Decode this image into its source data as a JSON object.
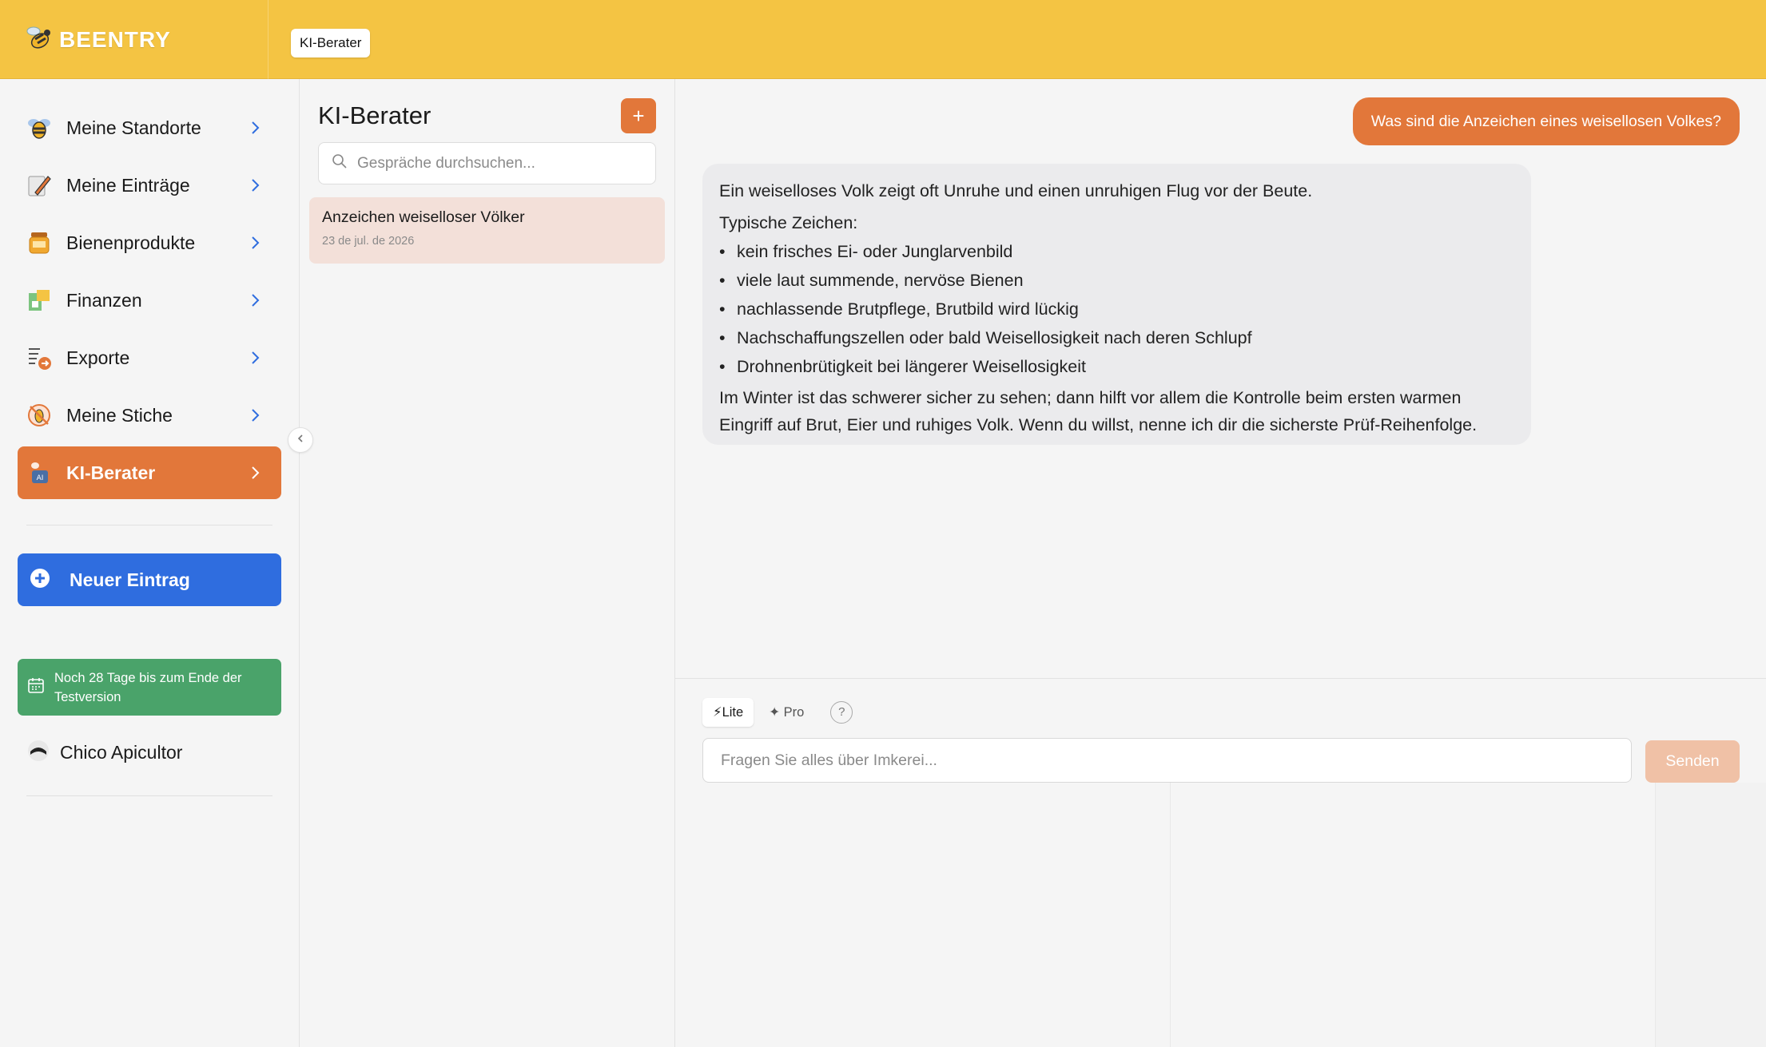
{
  "app": {
    "logo_text": "BEENTRY",
    "top_tab": "KI-Berater"
  },
  "sidebar": {
    "items": [
      {
        "label": "Meine Standorte",
        "icon": "bee-location-icon"
      },
      {
        "label": "Meine Einträge",
        "icon": "pen-entries-icon"
      },
      {
        "label": "Bienenprodukte",
        "icon": "honey-jar-icon"
      },
      {
        "label": "Finanzen",
        "icon": "finance-icon"
      },
      {
        "label": "Exporte",
        "icon": "export-icon"
      },
      {
        "label": "Meine Stiche",
        "icon": "sting-icon"
      },
      {
        "label": "KI-Berater",
        "icon": "ai-advisor-icon",
        "active": true
      }
    ],
    "new_entry_label": "Neuer Eintrag",
    "trial_text": "Noch 28 Tage bis zum Ende der Testversion",
    "user_name": "Chico Apicultor"
  },
  "conversations": {
    "title": "KI-Berater",
    "add_label": "+",
    "search_placeholder": "Gespräche durchsuchen...",
    "items": [
      {
        "title": "Anzeichen weiselloser Völker",
        "date": "23 de jul. de 2026"
      }
    ]
  },
  "chat": {
    "user_message": "Was sind die Anzeichen eines weisellosen Volkes?",
    "ai_intro": "Ein weiselloses Volk zeigt oft Unruhe und einen unruhigen Flug vor der Beute.",
    "ai_subhead": "Typische Zeichen:",
    "ai_bullets": [
      "kein frisches Ei- oder Junglarvenbild",
      "viele laut summende, nervöse Bienen",
      "nachlassende Brutpflege, Brutbild wird lückig",
      "Nachschaffungszellen oder bald Weisellosigkeit nach deren Schlupf",
      "Drohnenbrütigkeit bei längerer Weisellosigkeit"
    ],
    "ai_outro": "Im Winter ist das schwerer sicher zu sehen; dann hilft vor allem die Kontrolle beim ersten warmen Eingriff auf Brut, Eier und ruhiges Volk. Wenn du willst, nenne ich dir die sicherste Prüf-Reihenfolge."
  },
  "composer": {
    "mode_lite": "⚡Lite",
    "mode_pro": "✦ Pro",
    "help": "?",
    "input_placeholder": "Fragen Sie alles über Imkerei...",
    "send_label": "Senden"
  },
  "colors": {
    "topbar": "#f4c443",
    "accent_orange": "#e2773a",
    "primary_blue": "#2f6ddf",
    "trial_green": "#4aa36a"
  }
}
